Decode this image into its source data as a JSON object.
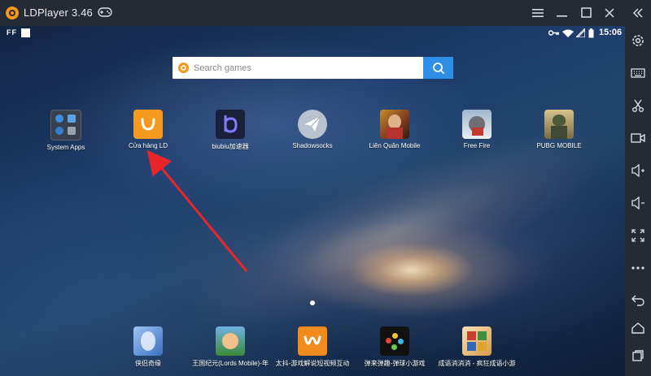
{
  "window": {
    "title": "LDPlayer 3.46"
  },
  "titlebar_buttons": [
    "menu-icon",
    "minimize-icon",
    "maximize-icon",
    "close-icon",
    "collapse-sidebar-icon"
  ],
  "status_bar": {
    "left_text": "FF",
    "time": "15:06"
  },
  "search": {
    "placeholder": "Search games"
  },
  "apps_top": [
    {
      "label": "System Apps",
      "icon": "system-apps-folder-icon"
    },
    {
      "label": "Cửa hàng LD",
      "icon": "ld-store-icon"
    },
    {
      "label": "biubiu加速器",
      "icon": "biubiu-accelerator-icon"
    },
    {
      "label": "Shadowsocks",
      "icon": "shadowsocks-icon"
    },
    {
      "label": "Liên Quân Mobile",
      "icon": "lien-quan-mobile-icon"
    },
    {
      "label": "Free Fire",
      "icon": "free-fire-icon"
    },
    {
      "label": "PUBG MOBILE",
      "icon": "pubg-mobile-icon"
    }
  ],
  "apps_dock": [
    {
      "label": "侠侣奇缘",
      "icon": "xialv-qiyuan-icon"
    },
    {
      "label": "王国纪元(Lords Mobile)-年",
      "icon": "lords-mobile-icon"
    },
    {
      "label": "太抖-游戏解说短视频互动",
      "icon": "taidou-icon"
    },
    {
      "label": "弹来弹趣-弹球小游戏",
      "icon": "dantan-game-icon"
    },
    {
      "label": "成语消消消 - 疯狂成语小游",
      "icon": "chengyu-game-icon"
    }
  ],
  "sidebar_tools": [
    "settings-icon",
    "keyboard-icon",
    "scissors-icon",
    "record-video-icon",
    "volume-up-icon",
    "volume-down-icon",
    "fullscreen-icon",
    "more-icon",
    "back-icon",
    "home-icon",
    "recent-apps-icon"
  ],
  "colors": {
    "chrome": "#262a33",
    "search_button": "#2f8fe6",
    "store_orange": "#f59a1f",
    "arrow": "#e8262a"
  }
}
